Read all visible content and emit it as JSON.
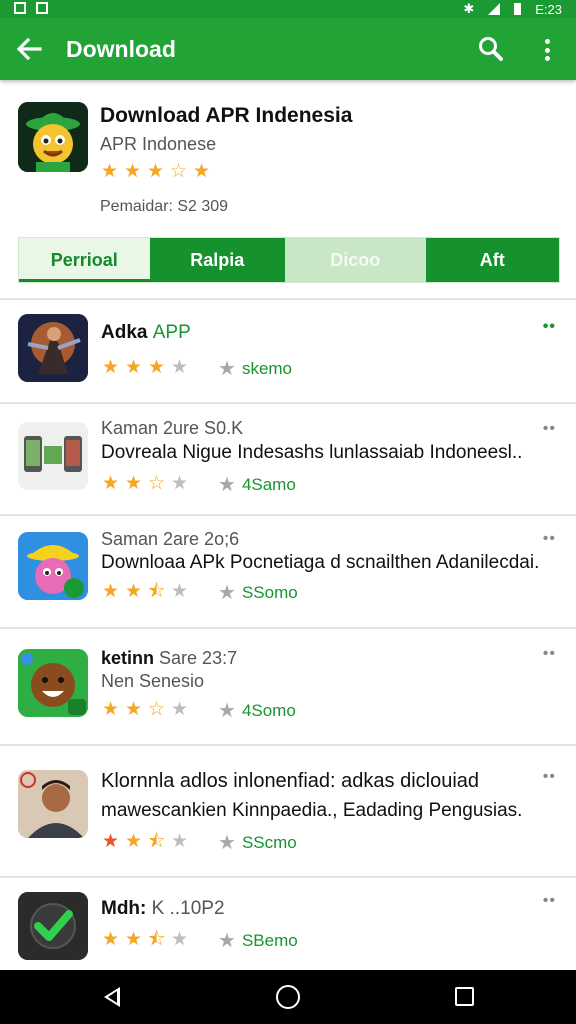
{
  "status_bar": {
    "time": "E:23"
  },
  "app_bar": {
    "back_icon": "arrow-left-icon",
    "title": "Download",
    "search_icon": "search-icon",
    "more_icon": "more-vert-icon",
    "color": "#21a336"
  },
  "header": {
    "title": "Download APR Indenesia",
    "developer": "APR Indonese",
    "rating": 3,
    "downloads": "Pemaidar: S2 309"
  },
  "tabs": [
    {
      "label": "Perrioal",
      "selected": true
    },
    {
      "label": "Ralpia",
      "selected": false
    },
    {
      "label": "Dicoo",
      "selected": false
    },
    {
      "label": "Aft",
      "selected": false
    }
  ],
  "list": [
    {
      "line1_a": "Adka",
      "line1_b": "APP",
      "stars": [
        "full",
        "full",
        "full",
        "empty"
      ],
      "meta": "skemo",
      "menu": "••"
    },
    {
      "line1": "Kaman 2ure S0.K",
      "line2": "Dovreala Nigue Indesashs lunlassaiab Indoneesl..",
      "stars": [
        "full",
        "full",
        "hollow",
        "empty"
      ],
      "meta": "4Samo",
      "menu": "••"
    },
    {
      "line1": "Saman 2are 2o;6",
      "line2": "Downloaa APk Pocnetiaga d scnailthen Adanilecdai.",
      "stars": [
        "full",
        "full",
        "half",
        "empty"
      ],
      "meta": "SSomo",
      "menu": "••"
    },
    {
      "line1_a": "ketinn",
      "line1_b": "Sare 23:7",
      "line2": "Nen Senesio",
      "stars": [
        "full",
        "full",
        "hollow",
        "empty"
      ],
      "meta": "4Somo",
      "menu": "••"
    },
    {
      "line1": "Klornnla adlos inlonenfiad: adkas diclouiad",
      "line2": "mawescankien Kinnpaedia., Eadading Pengusias.",
      "stars": [
        "red",
        "full",
        "half",
        "empty"
      ],
      "meta": "SScmo",
      "menu": "••"
    },
    {
      "line1_a": "Mdh:",
      "line1_b": "K ..10P2",
      "stars": [
        "full",
        "full",
        "half",
        "empty"
      ],
      "meta": "SBemo",
      "menu": "••"
    }
  ],
  "nav": {
    "back_icon": "nav-back-icon",
    "home_icon": "nav-home-icon",
    "recents_icon": "nav-recents-icon"
  }
}
